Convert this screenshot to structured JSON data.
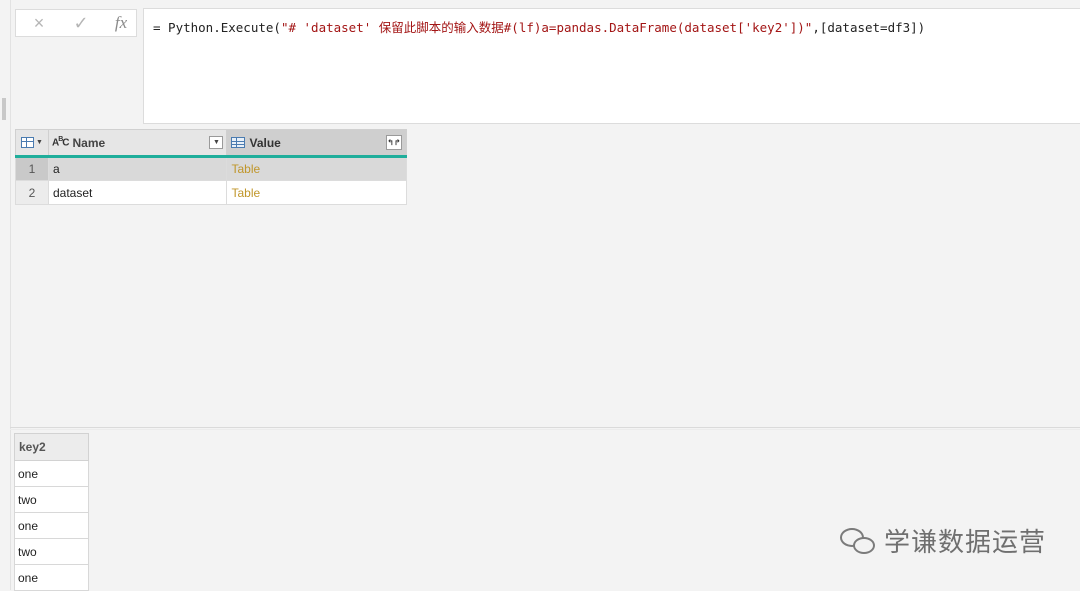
{
  "formula": {
    "cancel_icon": "×",
    "confirm_icon": "✓",
    "fx_label": "fx",
    "prefix": "= Python.Execute(",
    "script": "\"# 'dataset' 保留此脚本的输入数据#(lf)a=pandas.DataFrame(dataset['key2'])\"",
    "suffix": ",[dataset=df3])"
  },
  "grid": {
    "columns": [
      {
        "label": "Name",
        "type_icon": "text-type-icon"
      },
      {
        "label": "Value",
        "type_icon": "table-type-icon"
      }
    ],
    "rows": [
      {
        "num": "1",
        "name": "a",
        "value": "Table"
      },
      {
        "num": "2",
        "name": "dataset",
        "value": "Table"
      }
    ],
    "selected_row": 1
  },
  "preview": {
    "header": "key2",
    "rows": [
      "one",
      "two",
      "one",
      "two",
      "one"
    ]
  },
  "watermark": {
    "text": "学谦数据运营"
  },
  "colors": {
    "accent_teal": "#1fae9b",
    "table_link": "#c0962a",
    "string_red": "#a31515"
  }
}
